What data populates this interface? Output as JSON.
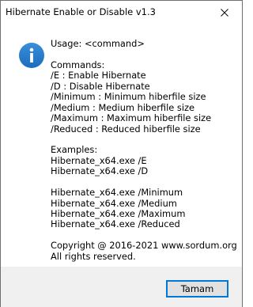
{
  "window": {
    "title": "Hibernate Enable or Disable v1.3"
  },
  "message": {
    "lines": [
      "Usage: <command>",
      "",
      "Commands:",
      "/E : Enable Hibernate",
      "/D : Disable Hibernate",
      "/Minimum : Minimum hiberfile size",
      "/Medium : Medium hiberfile size",
      "/Maximum : Maximum hiberfile size",
      "/Reduced : Reduced hiberfile size",
      "",
      "Examples:",
      "Hibernate_x64.exe /E",
      "Hibernate_x64.exe /D",
      "",
      "Hibernate_x64.exe /Minimum",
      "Hibernate_x64.exe /Medium",
      "Hibernate_x64.exe /Maximum",
      "Hibernate_x64.exe /Reduced",
      "",
      "Copyright @ 2016-2021 www.sordum.org",
      "All rights reserved."
    ]
  },
  "buttons": {
    "ok_label": "Tamam"
  },
  "icons": {
    "info": "information-icon",
    "close": "close-icon"
  },
  "colors": {
    "info_icon": "#1e78c8",
    "button_focus_border": "#0078d7",
    "footer_background": "#f0f0f0"
  }
}
